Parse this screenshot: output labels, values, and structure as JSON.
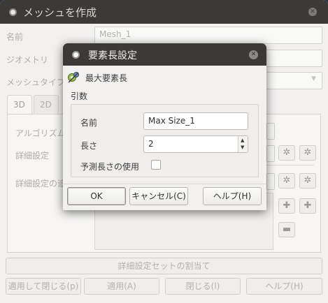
{
  "main_window": {
    "title": "メッシュを作成",
    "labels": {
      "name": "名前",
      "geometry": "ジオメトリ",
      "mesh_type": "メッシュタイプ",
      "algorithm": "アルゴリズム",
      "hypothesis": "詳細設定",
      "additional_hypothesis": "詳細設定の追加"
    },
    "name_value": "Mesh_1",
    "tabs": [
      {
        "label": "3D",
        "active": true
      },
      {
        "label": "2D",
        "active": false
      }
    ],
    "assign_hypothesis_set_button": "詳細設定セットの割当て",
    "bottom_buttons": {
      "apply_close": "適用して閉じる(p)",
      "apply": "適用(A)",
      "close": "閉じる(l)",
      "help": "ヘルプ(H)"
    }
  },
  "dialog": {
    "title": "要素長設定",
    "hypothesis_name": "最大要素長",
    "arguments_label": "引数",
    "name_label": "名前",
    "name_value": "Max Size_1",
    "length_label": "長さ",
    "length_value": "2",
    "use_preestimated_label": "予測長さの使用",
    "use_preestimated_checked": false,
    "buttons": {
      "ok": "OK",
      "cancel": "キャンセル(C)",
      "help": "ヘルプ(H)"
    }
  },
  "colors": {
    "titlebar": "#3b3a36",
    "window_bg": "#f2f1f0",
    "desktop": "#2a3440"
  }
}
